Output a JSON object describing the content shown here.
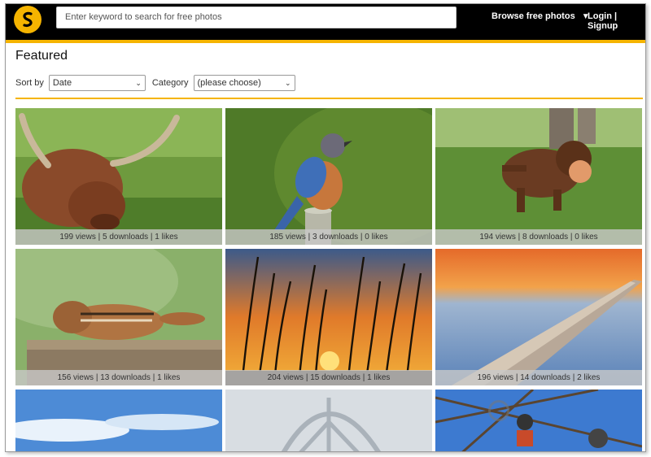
{
  "header": {
    "search_placeholder": "Enter keyword to search for free photos",
    "browse_label": "Browse free photos",
    "browse_caret": "▼",
    "login_label": "Login",
    "auth_separator": " | ",
    "signup_label": "Signup"
  },
  "page": {
    "title": "Featured"
  },
  "filters": {
    "sort_label": "Sort by",
    "sort_value": "Date",
    "category_label": "Category",
    "category_value": "(please choose)"
  },
  "photos": [
    {
      "subject": "highland cow",
      "stats": "199 views | 5 downloads | 1 likes"
    },
    {
      "subject": "bluebird",
      "stats": "185 views | 3 downloads | 0 likes"
    },
    {
      "subject": "puppy with ball",
      "stats": "194 views | 8 downloads | 0 likes"
    },
    {
      "subject": "chipmunk",
      "stats": "156 views | 13 downloads | 1 likes"
    },
    {
      "subject": "reeds at sunset",
      "stats": "204 views | 15 downloads | 1 likes"
    },
    {
      "subject": "pier at sunset",
      "stats": "196 views | 14 downloads | 2 likes"
    },
    {
      "subject": "blue sky",
      "stats": ""
    },
    {
      "subject": "snow drawing",
      "stats": ""
    },
    {
      "subject": "workers on rig",
      "stats": ""
    }
  ],
  "colors": {
    "brand": "#f5b400",
    "header_bg": "#000000"
  }
}
